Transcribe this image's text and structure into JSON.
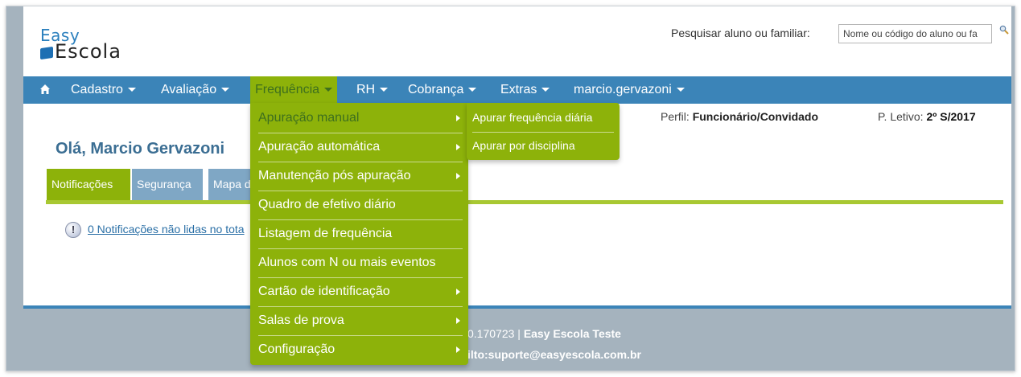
{
  "logo": {
    "line1": "Easy",
    "line2": "Escola"
  },
  "search": {
    "label": "Pesquisar aluno ou familiar:",
    "placeholder": "Nome ou código do aluno ou fa"
  },
  "navbar": {
    "items": [
      {
        "label": "Cadastro"
      },
      {
        "label": "Avaliação"
      },
      {
        "label": "Frequência"
      },
      {
        "label": "RH"
      },
      {
        "label": "Cobrança"
      },
      {
        "label": "Extras"
      },
      {
        "label": "marcio.gervazoni"
      }
    ],
    "active": "Frequência"
  },
  "profile": {
    "perfil_label": "Perfil:",
    "perfil_value": "Funcionário/Convidado",
    "letivo_label": "P. Letivo:",
    "letivo_value": "2º S/2017"
  },
  "greeting": "Olá, Marcio Gervazoni",
  "tabs": [
    {
      "label": "Notificações"
    },
    {
      "label": "Segurança"
    },
    {
      "label": "Mapa d"
    }
  ],
  "notifications": {
    "link": "0 Notificações não lidas no tota"
  },
  "footer": {
    "line1_prefix": "0.170723 |",
    "line1_bold": "Easy Escola Teste",
    "line2": "ilto:suporte@easyescola.com.br"
  },
  "dropdown": {
    "items": [
      {
        "label": "Apuração manual",
        "submenu": true
      },
      {
        "label": "Apuração automática",
        "submenu": true
      },
      {
        "label": "Manutenção pós apuração",
        "submenu": true
      },
      {
        "label": "Quadro de efetivo diário",
        "submenu": false
      },
      {
        "label": "Listagem de frequência",
        "submenu": false
      },
      {
        "label": "Alunos com N ou mais eventos",
        "submenu": false
      },
      {
        "label": "Cartão de identificação",
        "submenu": true
      },
      {
        "label": "Salas de prova",
        "submenu": true
      },
      {
        "label": "Configuração",
        "submenu": true
      }
    ]
  },
  "submenu": {
    "items": [
      {
        "label": "Apurar frequência diária"
      },
      {
        "label": "Apurar por disciplina"
      }
    ]
  },
  "colors": {
    "nav_blue": "#3b84b8",
    "menu_green": "#8db20a",
    "link_blue": "#2a6fa6"
  }
}
